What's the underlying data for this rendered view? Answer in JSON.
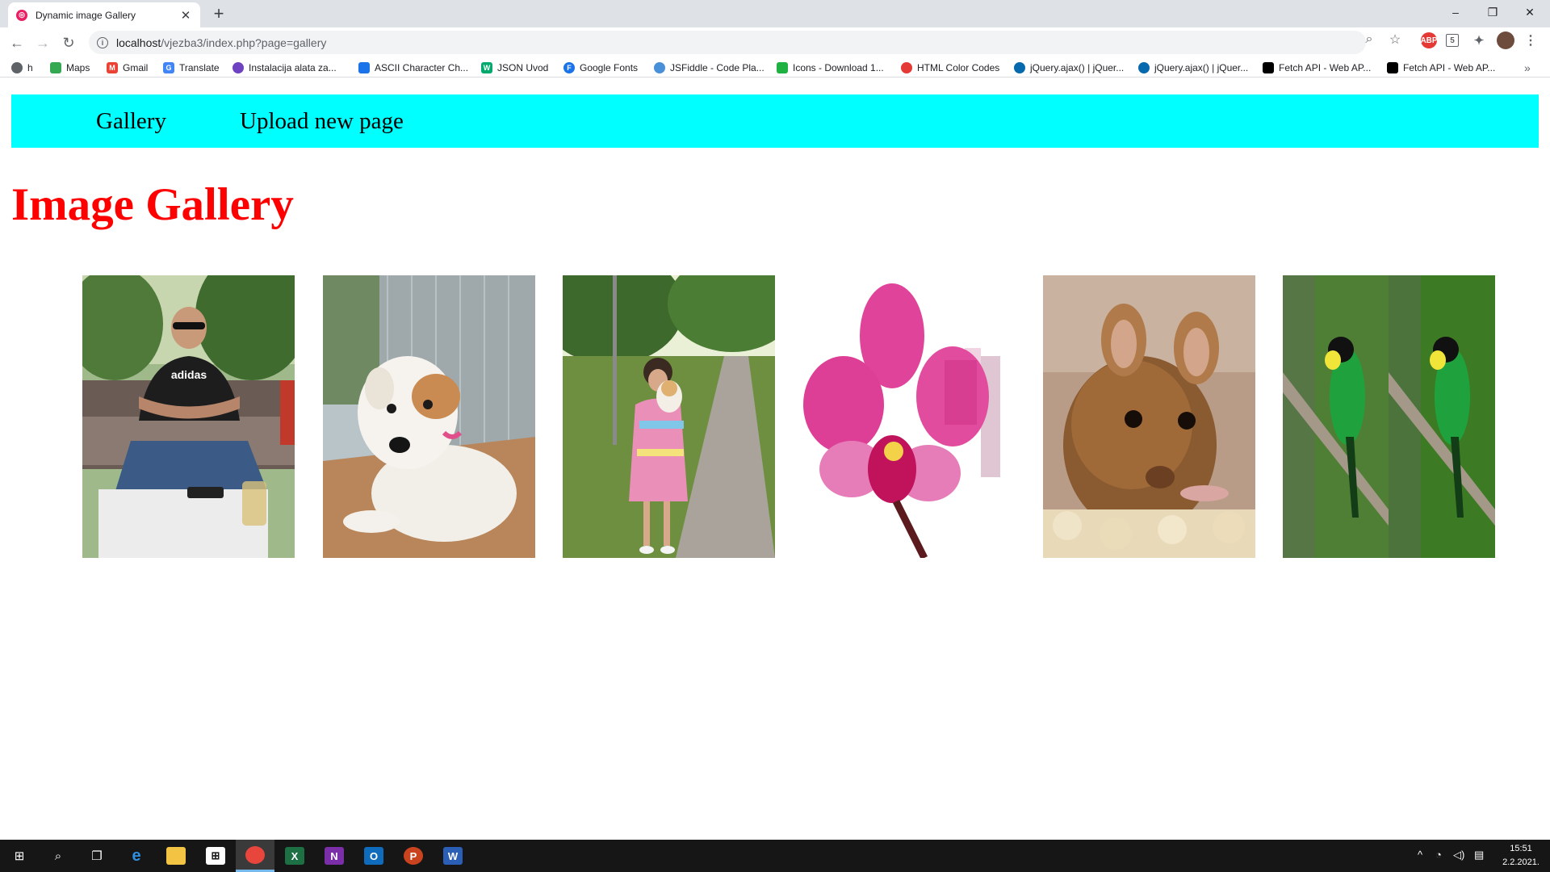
{
  "browser": {
    "tab_title": "Dynamic image Gallery",
    "address": {
      "host": "localhost",
      "path": "/vjezba3/index.php?page=gallery"
    },
    "bookmarks": [
      {
        "label": "h",
        "icon": "globe-icon",
        "color": "#5f6368"
      },
      {
        "label": "Maps",
        "icon": "maps-icon",
        "color": "#34a853"
      },
      {
        "label": "Gmail",
        "icon": "gmail-icon",
        "color": "#ea4335"
      },
      {
        "label": "Translate",
        "icon": "translate-icon",
        "color": "#4285f4"
      },
      {
        "label": "Instalacija alata za...",
        "icon": "bookmark-icon",
        "color": "#6f42c1"
      },
      {
        "label": "ASCII Character Ch...",
        "icon": "bookmark-icon",
        "color": "#1a73e8"
      },
      {
        "label": "JSON Uvod",
        "icon": "w3schools-icon",
        "color": "#04aa6d"
      },
      {
        "label": "Google Fonts",
        "icon": "fonts-icon",
        "color": "#1a73e8"
      },
      {
        "label": "JSFiddle - Code Pla...",
        "icon": "cloud-icon",
        "color": "#4a90d9"
      },
      {
        "label": "Icons - Download 1...",
        "icon": "icons8-icon",
        "color": "#1fb141"
      },
      {
        "label": "HTML Color Codes",
        "icon": "color-icon",
        "color": "#e53935"
      },
      {
        "label": "jQuery.ajax() | jQuer...",
        "icon": "jquery-icon",
        "color": "#0769ad"
      },
      {
        "label": "jQuery.ajax() | jQuer...",
        "icon": "jquery-icon",
        "color": "#0769ad"
      },
      {
        "label": "Fetch API - Web AP...",
        "icon": "mdn-icon",
        "color": "#000000"
      },
      {
        "label": "Fetch API - Web AP...",
        "icon": "mdn-icon",
        "color": "#000000"
      }
    ],
    "more_bookmarks": "»"
  },
  "page": {
    "nav": [
      "Gallery",
      "Upload new page"
    ],
    "heading": "Image Gallery",
    "heading_color": "#ff0000",
    "nav_color": "#00ffff",
    "images": [
      {
        "subject": "man-in-adidas-shirt"
      },
      {
        "subject": "white-terrier-dog"
      },
      {
        "subject": "girl-holding-puppy"
      },
      {
        "subject": "pink-orchid"
      },
      {
        "subject": "brown-mouse"
      },
      {
        "subject": "green-parrots"
      }
    ]
  },
  "taskbar": {
    "apps": [
      "start-icon",
      "search-icon",
      "task-view-icon",
      "edge-icon",
      "file-explorer-icon",
      "store-icon",
      "chrome-icon",
      "excel-icon",
      "onenote-icon",
      "outlook-icon",
      "powerpoint-icon",
      "word-icon"
    ],
    "time": "15:51",
    "date": "2.2.2021."
  }
}
